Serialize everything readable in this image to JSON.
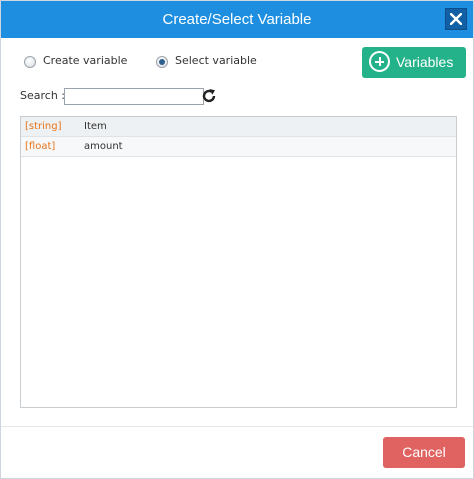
{
  "dialog": {
    "title": "Create/Select Variable"
  },
  "mode": {
    "create_label": "Create variable",
    "select_label": "Select variable",
    "selected": "select"
  },
  "toolbar": {
    "add_variables_label": "Variables"
  },
  "search": {
    "label": "Search :",
    "value": ""
  },
  "variables": [
    {
      "type": "[string]",
      "name": "Item"
    },
    {
      "type": "[float]",
      "name": "amount"
    }
  ],
  "footer": {
    "cancel_label": "Cancel"
  },
  "colors": {
    "titlebar": "#1e8fe0",
    "add_button": "#23b28a",
    "cancel_button": "#e06362",
    "type_text": "#e8741a"
  },
  "icons": [
    "close-icon",
    "plus-circle-icon",
    "refresh-icon"
  ]
}
